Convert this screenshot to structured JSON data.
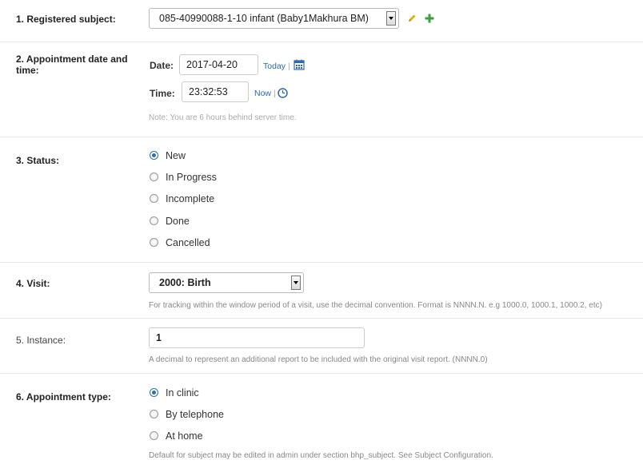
{
  "subject": {
    "label": "1. Registered subject:",
    "value": "085-40990088-1-10 infant (Baby1Makhura BM)",
    "edit_icon": "pencil-icon",
    "add_icon": "plus-icon"
  },
  "appointment": {
    "label": "2. Appointment date and time:",
    "date_label": "Date:",
    "date_value": "2017-04-20",
    "today_link": "Today",
    "sep": "|",
    "time_label": "Time:",
    "time_value": "23:32:53",
    "now_link": "Now",
    "note": "Note: You are 6 hours behind server time."
  },
  "status": {
    "label": "3. Status:",
    "options": [
      "New",
      "In Progress",
      "Incomplete",
      "Done",
      "Cancelled"
    ],
    "selected": "New"
  },
  "visit": {
    "label": "4. Visit:",
    "value": "2000: Birth",
    "help": "For tracking within the window period of a visit, use the decimal convention. Format is NNNN.N. e.g 1000.0, 1000.1, 1000.2, etc)"
  },
  "instance": {
    "label": "5. Instance:",
    "value": "1",
    "help": "A decimal to represent an additional report to be included with the original visit report. (NNNN.0)"
  },
  "appt_type": {
    "label": "6. Appointment type:",
    "options": [
      "In clinic",
      "By telephone",
      "At home"
    ],
    "selected": "In clinic",
    "help": "Default for subject may be edited in admin under section bhp_subject. See Subject Configuration."
  },
  "colors": {
    "accent": "#2f6fa8",
    "link": "#2a6ab0",
    "add": "#3aa23a",
    "edit": "#e0b000"
  }
}
